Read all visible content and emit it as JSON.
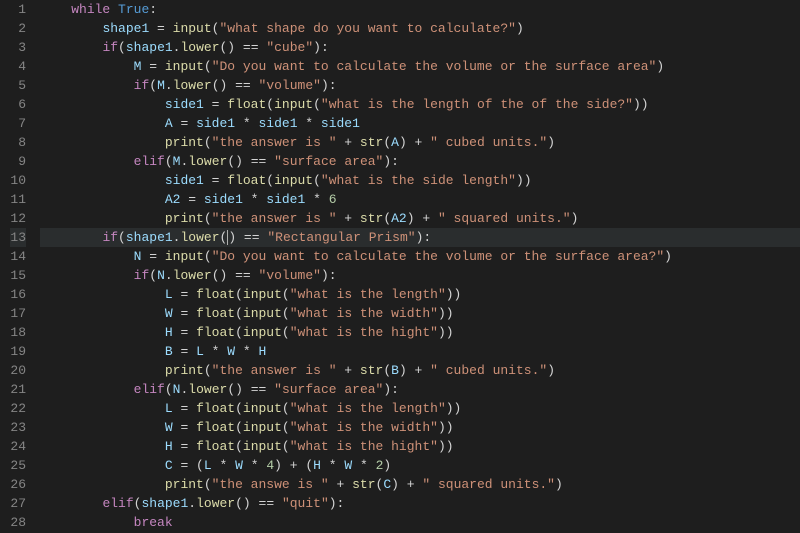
{
  "code": {
    "lines": [
      {
        "n": "1",
        "tokens": [
          [
            "kw-flow",
            "while"
          ],
          [
            "op",
            " "
          ],
          [
            "kw-const",
            "True"
          ],
          [
            "pn",
            ":"
          ]
        ]
      },
      {
        "n": "2",
        "tokens": [
          [
            "op",
            "    "
          ],
          [
            "var",
            "shape1"
          ],
          [
            "op",
            " = "
          ],
          [
            "fn",
            "input"
          ],
          [
            "pn",
            "("
          ],
          [
            "str",
            "\"what shape do you want to calculate?\""
          ],
          [
            "pn",
            ")"
          ]
        ]
      },
      {
        "n": "3",
        "tokens": [
          [
            "op",
            "    "
          ],
          [
            "kw-flow",
            "if"
          ],
          [
            "pn",
            "("
          ],
          [
            "var",
            "shape1"
          ],
          [
            "pn",
            "."
          ],
          [
            "fn",
            "lower"
          ],
          [
            "pn",
            "()"
          ],
          [
            "op",
            " == "
          ],
          [
            "str",
            "\"cube\""
          ],
          [
            "pn",
            "):"
          ]
        ]
      },
      {
        "n": "4",
        "tokens": [
          [
            "op",
            "        "
          ],
          [
            "var",
            "M"
          ],
          [
            "op",
            " = "
          ],
          [
            "fn",
            "input"
          ],
          [
            "pn",
            "("
          ],
          [
            "str",
            "\"Do you want to calculate the volume or the surface area\""
          ],
          [
            "pn",
            ")"
          ]
        ]
      },
      {
        "n": "5",
        "tokens": [
          [
            "op",
            "        "
          ],
          [
            "kw-flow",
            "if"
          ],
          [
            "pn",
            "("
          ],
          [
            "var",
            "M"
          ],
          [
            "pn",
            "."
          ],
          [
            "fn",
            "lower"
          ],
          [
            "pn",
            "()"
          ],
          [
            "op",
            " == "
          ],
          [
            "str",
            "\"volume\""
          ],
          [
            "pn",
            "):"
          ]
        ]
      },
      {
        "n": "6",
        "tokens": [
          [
            "op",
            "            "
          ],
          [
            "var",
            "side1"
          ],
          [
            "op",
            " = "
          ],
          [
            "fn",
            "float"
          ],
          [
            "pn",
            "("
          ],
          [
            "fn",
            "input"
          ],
          [
            "pn",
            "("
          ],
          [
            "str",
            "\"what is the length of the of the side?\""
          ],
          [
            "pn",
            "))"
          ]
        ]
      },
      {
        "n": "7",
        "tokens": [
          [
            "op",
            "            "
          ],
          [
            "var",
            "A"
          ],
          [
            "op",
            " = "
          ],
          [
            "var",
            "side1"
          ],
          [
            "op",
            " * "
          ],
          [
            "var",
            "side1"
          ],
          [
            "op",
            " * "
          ],
          [
            "var",
            "side1"
          ]
        ]
      },
      {
        "n": "8",
        "tokens": [
          [
            "op",
            "            "
          ],
          [
            "fn",
            "print"
          ],
          [
            "pn",
            "("
          ],
          [
            "str",
            "\"the answer is \""
          ],
          [
            "op",
            " + "
          ],
          [
            "fn",
            "str"
          ],
          [
            "pn",
            "("
          ],
          [
            "var",
            "A"
          ],
          [
            "pn",
            ")"
          ],
          [
            "op",
            " + "
          ],
          [
            "str",
            "\" cubed units.\""
          ],
          [
            "pn",
            ")"
          ]
        ]
      },
      {
        "n": "9",
        "tokens": [
          [
            "op",
            "        "
          ],
          [
            "kw-flow",
            "elif"
          ],
          [
            "pn",
            "("
          ],
          [
            "var",
            "M"
          ],
          [
            "pn",
            "."
          ],
          [
            "fn",
            "lower"
          ],
          [
            "pn",
            "()"
          ],
          [
            "op",
            " == "
          ],
          [
            "str",
            "\"surface area\""
          ],
          [
            "pn",
            "):"
          ]
        ]
      },
      {
        "n": "10",
        "tokens": [
          [
            "op",
            "            "
          ],
          [
            "var",
            "side1"
          ],
          [
            "op",
            " = "
          ],
          [
            "fn",
            "float"
          ],
          [
            "pn",
            "("
          ],
          [
            "fn",
            "input"
          ],
          [
            "pn",
            "("
          ],
          [
            "str",
            "\"what is the side length\""
          ],
          [
            "pn",
            "))"
          ]
        ]
      },
      {
        "n": "11",
        "tokens": [
          [
            "op",
            "            "
          ],
          [
            "var",
            "A2"
          ],
          [
            "op",
            " = "
          ],
          [
            "var",
            "side1"
          ],
          [
            "op",
            " * "
          ],
          [
            "var",
            "side1"
          ],
          [
            "op",
            " * "
          ],
          [
            "num",
            "6"
          ]
        ]
      },
      {
        "n": "12",
        "tokens": [
          [
            "op",
            "            "
          ],
          [
            "fn",
            "print"
          ],
          [
            "pn",
            "("
          ],
          [
            "str",
            "\"the answer is \""
          ],
          [
            "op",
            " + "
          ],
          [
            "fn",
            "str"
          ],
          [
            "pn",
            "("
          ],
          [
            "var",
            "A2"
          ],
          [
            "pn",
            ")"
          ],
          [
            "op",
            " + "
          ],
          [
            "str",
            "\" squared units.\""
          ],
          [
            "pn",
            ")"
          ]
        ]
      },
      {
        "n": "13",
        "tokens": [
          [
            "op",
            "    "
          ],
          [
            "kw-flow",
            "if"
          ],
          [
            "pn",
            "("
          ],
          [
            "var",
            "shape1"
          ],
          [
            "pn",
            "."
          ],
          [
            "fn",
            "lower"
          ],
          [
            "pn",
            "("
          ],
          [
            "cursor",
            ""
          ],
          [
            "pn",
            ")"
          ],
          [
            "op",
            " == "
          ],
          [
            "str",
            "\"Rectangular Prism\""
          ],
          [
            "pn",
            "):"
          ]
        ],
        "highlight": true
      },
      {
        "n": "14",
        "tokens": [
          [
            "op",
            "        "
          ],
          [
            "var",
            "N"
          ],
          [
            "op",
            " = "
          ],
          [
            "fn",
            "input"
          ],
          [
            "pn",
            "("
          ],
          [
            "str",
            "\"Do you want to calculate the volume or the surface area?\""
          ],
          [
            "pn",
            ")"
          ]
        ]
      },
      {
        "n": "15",
        "tokens": [
          [
            "op",
            "        "
          ],
          [
            "kw-flow",
            "if"
          ],
          [
            "pn",
            "("
          ],
          [
            "var",
            "N"
          ],
          [
            "pn",
            "."
          ],
          [
            "fn",
            "lower"
          ],
          [
            "pn",
            "()"
          ],
          [
            "op",
            " == "
          ],
          [
            "str",
            "\"volume\""
          ],
          [
            "pn",
            "):"
          ]
        ]
      },
      {
        "n": "16",
        "tokens": [
          [
            "op",
            "            "
          ],
          [
            "var",
            "L"
          ],
          [
            "op",
            " = "
          ],
          [
            "fn",
            "float"
          ],
          [
            "pn",
            "("
          ],
          [
            "fn",
            "input"
          ],
          [
            "pn",
            "("
          ],
          [
            "str",
            "\"what is the length\""
          ],
          [
            "pn",
            "))"
          ]
        ]
      },
      {
        "n": "17",
        "tokens": [
          [
            "op",
            "            "
          ],
          [
            "var",
            "W"
          ],
          [
            "op",
            " = "
          ],
          [
            "fn",
            "float"
          ],
          [
            "pn",
            "("
          ],
          [
            "fn",
            "input"
          ],
          [
            "pn",
            "("
          ],
          [
            "str",
            "\"what is the width\""
          ],
          [
            "pn",
            "))"
          ]
        ]
      },
      {
        "n": "18",
        "tokens": [
          [
            "op",
            "            "
          ],
          [
            "var",
            "H"
          ],
          [
            "op",
            " = "
          ],
          [
            "fn",
            "float"
          ],
          [
            "pn",
            "("
          ],
          [
            "fn",
            "input"
          ],
          [
            "pn",
            "("
          ],
          [
            "str",
            "\"what is the hight\""
          ],
          [
            "pn",
            "))"
          ]
        ]
      },
      {
        "n": "19",
        "tokens": [
          [
            "op",
            "            "
          ],
          [
            "var",
            "B"
          ],
          [
            "op",
            " = "
          ],
          [
            "var",
            "L"
          ],
          [
            "op",
            " * "
          ],
          [
            "var",
            "W"
          ],
          [
            "op",
            " * "
          ],
          [
            "var",
            "H"
          ]
        ]
      },
      {
        "n": "20",
        "tokens": [
          [
            "op",
            "            "
          ],
          [
            "fn",
            "print"
          ],
          [
            "pn",
            "("
          ],
          [
            "str",
            "\"the answer is \""
          ],
          [
            "op",
            " + "
          ],
          [
            "fn",
            "str"
          ],
          [
            "pn",
            "("
          ],
          [
            "var",
            "B"
          ],
          [
            "pn",
            ")"
          ],
          [
            "op",
            " + "
          ],
          [
            "str",
            "\" cubed units.\""
          ],
          [
            "pn",
            ")"
          ]
        ]
      },
      {
        "n": "21",
        "tokens": [
          [
            "op",
            "        "
          ],
          [
            "kw-flow",
            "elif"
          ],
          [
            "pn",
            "("
          ],
          [
            "var",
            "N"
          ],
          [
            "pn",
            "."
          ],
          [
            "fn",
            "lower"
          ],
          [
            "pn",
            "()"
          ],
          [
            "op",
            " == "
          ],
          [
            "str",
            "\"surface area\""
          ],
          [
            "pn",
            "):"
          ]
        ]
      },
      {
        "n": "22",
        "tokens": [
          [
            "op",
            "            "
          ],
          [
            "var",
            "L"
          ],
          [
            "op",
            " = "
          ],
          [
            "fn",
            "float"
          ],
          [
            "pn",
            "("
          ],
          [
            "fn",
            "input"
          ],
          [
            "pn",
            "("
          ],
          [
            "str",
            "\"what is the length\""
          ],
          [
            "pn",
            "))"
          ]
        ]
      },
      {
        "n": "23",
        "tokens": [
          [
            "op",
            "            "
          ],
          [
            "var",
            "W"
          ],
          [
            "op",
            " = "
          ],
          [
            "fn",
            "float"
          ],
          [
            "pn",
            "("
          ],
          [
            "fn",
            "input"
          ],
          [
            "pn",
            "("
          ],
          [
            "str",
            "\"what is the width\""
          ],
          [
            "pn",
            "))"
          ]
        ]
      },
      {
        "n": "24",
        "tokens": [
          [
            "op",
            "            "
          ],
          [
            "var",
            "H"
          ],
          [
            "op",
            " = "
          ],
          [
            "fn",
            "float"
          ],
          [
            "pn",
            "("
          ],
          [
            "fn",
            "input"
          ],
          [
            "pn",
            "("
          ],
          [
            "str",
            "\"what is the hight\""
          ],
          [
            "pn",
            "))"
          ]
        ]
      },
      {
        "n": "25",
        "tokens": [
          [
            "op",
            "            "
          ],
          [
            "var",
            "C"
          ],
          [
            "op",
            " = ("
          ],
          [
            "var",
            "L"
          ],
          [
            "op",
            " * "
          ],
          [
            "var",
            "W"
          ],
          [
            "op",
            " * "
          ],
          [
            "num",
            "4"
          ],
          [
            "op",
            ") + ("
          ],
          [
            "var",
            "H"
          ],
          [
            "op",
            " * "
          ],
          [
            "var",
            "W"
          ],
          [
            "op",
            " * "
          ],
          [
            "num",
            "2"
          ],
          [
            "op",
            ")"
          ]
        ]
      },
      {
        "n": "26",
        "tokens": [
          [
            "op",
            "            "
          ],
          [
            "fn",
            "print"
          ],
          [
            "pn",
            "("
          ],
          [
            "str",
            "\"the answe is \""
          ],
          [
            "op",
            " + "
          ],
          [
            "fn",
            "str"
          ],
          [
            "pn",
            "("
          ],
          [
            "var",
            "C"
          ],
          [
            "pn",
            ")"
          ],
          [
            "op",
            " + "
          ],
          [
            "str",
            "\" squared units.\""
          ],
          [
            "pn",
            ")"
          ]
        ]
      },
      {
        "n": "27",
        "tokens": [
          [
            "op",
            "    "
          ],
          [
            "kw-flow",
            "elif"
          ],
          [
            "pn",
            "("
          ],
          [
            "var",
            "shape1"
          ],
          [
            "pn",
            "."
          ],
          [
            "fn",
            "lower"
          ],
          [
            "pn",
            "()"
          ],
          [
            "op",
            " == "
          ],
          [
            "str",
            "\"quit\""
          ],
          [
            "pn",
            "):"
          ]
        ]
      },
      {
        "n": "28",
        "tokens": [
          [
            "op",
            "        "
          ],
          [
            "kw-flow",
            "break"
          ]
        ]
      }
    ],
    "base_indent": "    "
  }
}
